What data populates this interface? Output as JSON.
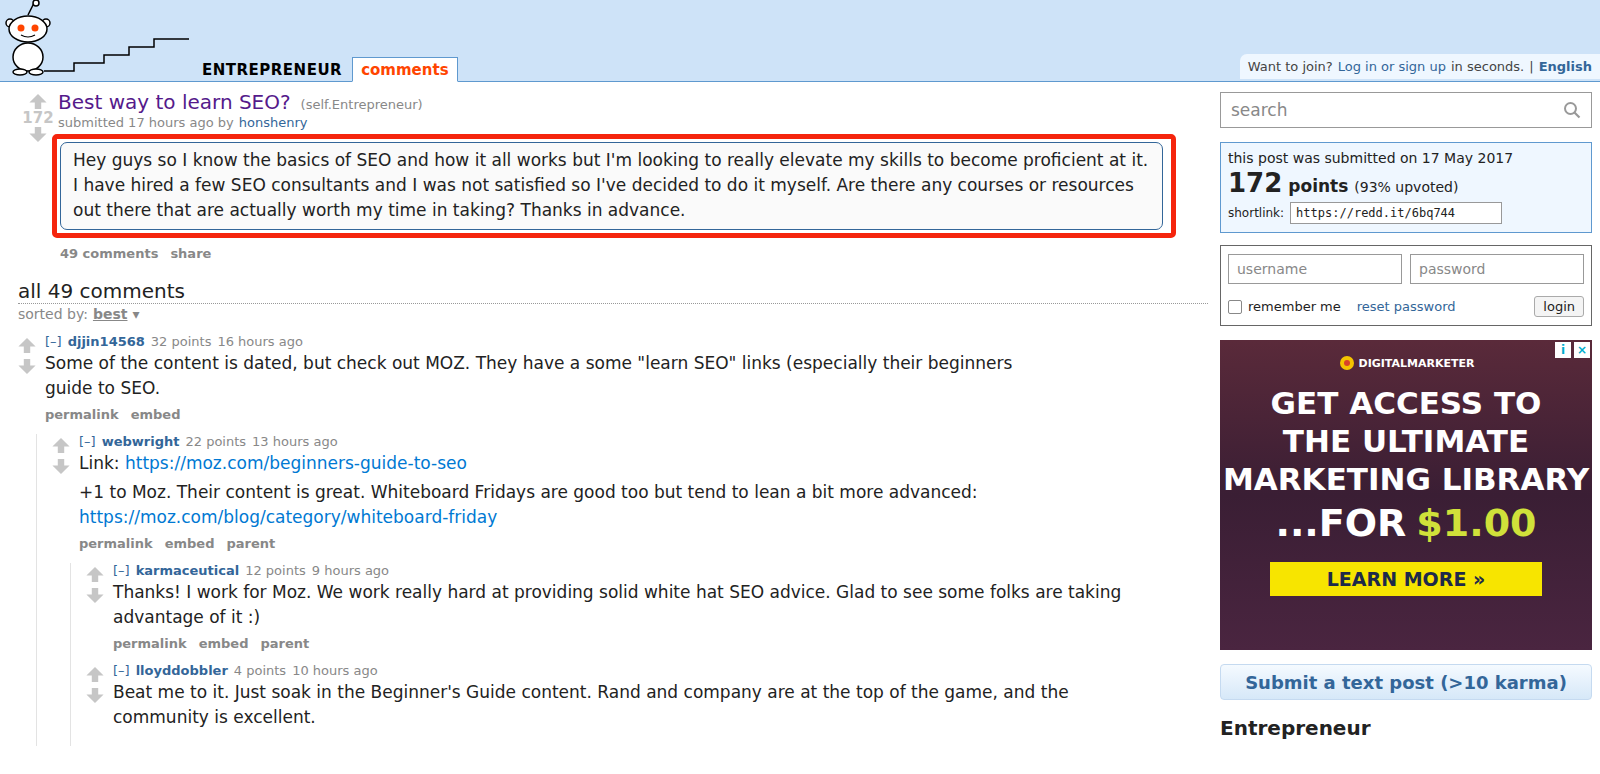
{
  "header": {
    "subreddit": "ENTREPRENEUR",
    "tabs": [
      {
        "label": "comments",
        "selected": true
      }
    ],
    "join_text": "Want to join?",
    "join_link": "Log in or sign up",
    "join_suffix": "in seconds.",
    "separator": "|",
    "language": "English"
  },
  "post": {
    "score": "172",
    "title": "Best way to learn SEO?",
    "domain": "(self.Entrepreneur)",
    "tagline": "submitted 17 hours ago by",
    "author": "honshenry",
    "selftext": "Hey guys so I know the basics of SEO and how it all works but I'm looking to really elevate my skills to become proficient at it. I have hired a few SEO consultants and I was not satisfied so I've decided to do it myself. Are there any courses or resources out there that are actually worth my time in taking? Thanks in advance.",
    "buttons": [
      "49 comments",
      "share"
    ]
  },
  "comment_area": {
    "title": "all 49 comments",
    "sort_label": "sorted by:",
    "sort_value": "best",
    "sort_icon": "▾",
    "collapse": "[–]"
  },
  "comments": [
    {
      "author": "djjin14568",
      "score": "32 points",
      "time": "16 hours ago",
      "body": [
        [
          {
            "text": "Some of the content is dated, but check out MOZ. They have a some \"learn SEO\" links (especially their beginners guide to SEO.",
            "link": false
          }
        ]
      ],
      "buttons": [
        "permalink",
        "embed"
      ],
      "children": [
        {
          "author": "webwright",
          "score": "22 points",
          "time": "13 hours ago",
          "body": [
            [
              {
                "text": "Link: ",
                "link": false
              },
              {
                "text": "https://moz.com/beginners-guide-to-seo",
                "link": true
              }
            ],
            [
              {
                "text": "+1 to Moz. Their content is great. Whiteboard Fridays are good too but tend to lean a bit more advanced: ",
                "link": false
              },
              {
                "text": "https://moz.com/blog/category/whiteboard-friday",
                "link": true
              }
            ]
          ],
          "buttons": [
            "permalink",
            "embed",
            "parent"
          ],
          "children": [
            {
              "author": "karmaceutical",
              "score": "12 points",
              "time": "9 hours ago",
              "body": [
                [
                  {
                    "text": "Thanks! I work for Moz. We work really hard at providing solid white hat SEO advice. Glad to see some folks are taking advantage of it :)",
                    "link": false
                  }
                ]
              ],
              "buttons": [
                "permalink",
                "embed",
                "parent"
              ],
              "children": []
            },
            {
              "author": "lloyddobbler",
              "score": "4 points",
              "time": "10 hours ago",
              "body": [
                [
                  {
                    "text": "Beat me to it. Just soak in the Beginner's Guide content. Rand and company are at the top of the game, and the community is excellent.",
                    "link": false
                  }
                ]
              ],
              "buttons": [],
              "children": []
            }
          ]
        }
      ]
    }
  ],
  "sidebar": {
    "search_placeholder": "search",
    "submitted": "this post was submitted on 17 May 2017",
    "points": "172",
    "points_label": "points",
    "upvoted": "(93% upvoted)",
    "shortlink_label": "shortlink:",
    "shortlink": "https://redd.it/6bq744",
    "login": {
      "username": "username",
      "password": "password",
      "remember": "remember me",
      "remember_checked": false,
      "reset": "reset password",
      "button": "login"
    },
    "ad": {
      "brand": "DIGITALMARKETER",
      "lines": [
        "GET ACCESS TO",
        "THE ULTIMATE",
        "MARKETING LIBRARY"
      ],
      "price_prefix": "...FOR",
      "price": "$1.00",
      "cta": "LEARN MORE »",
      "info": "i",
      "close": "×"
    },
    "submit": "Submit a text post (>10 karma)",
    "title": "Entrepreneur"
  }
}
